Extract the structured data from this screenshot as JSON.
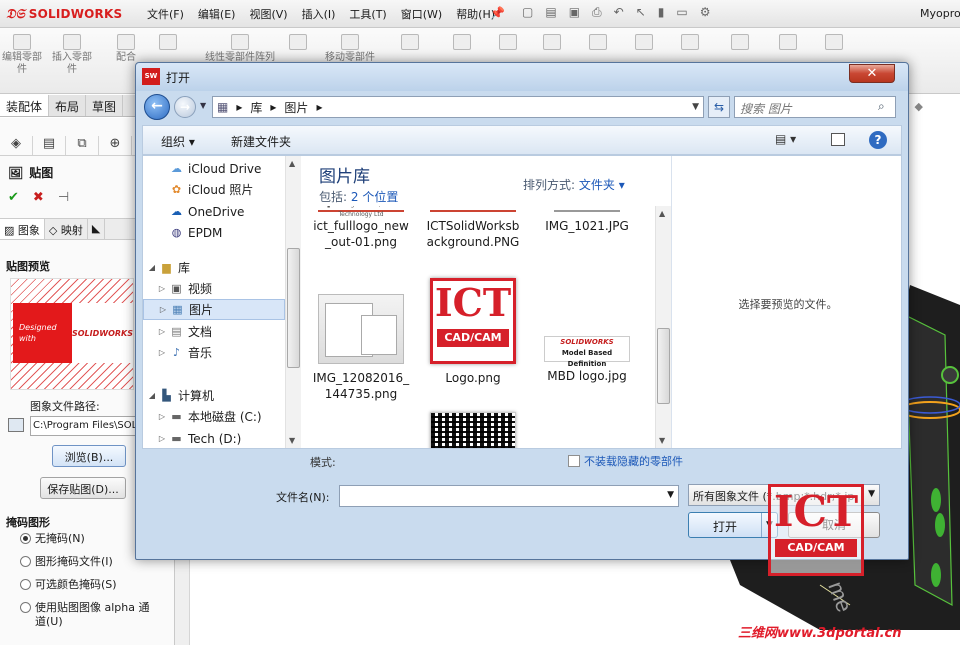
{
  "app": {
    "logo_text": "SOLIDWORKS",
    "menus": [
      "文件(F)",
      "编辑(E)",
      "视图(V)",
      "插入(I)",
      "工具(T)",
      "窗口(W)",
      "帮助(H)"
    ],
    "doc_title": "Myopro"
  },
  "ribbon": {
    "buttons": [
      "编辑零部件",
      "插入零部件",
      "配合",
      "",
      "线性零部件阵列",
      "",
      "移动零部件",
      "",
      "",
      "",
      "",
      "",
      "",
      "",
      "",
      "",
      ""
    ]
  },
  "tabs": [
    "装配体",
    "布局",
    "草图"
  ],
  "property_manager": {
    "title": "贴图",
    "subtabs": [
      "图象",
      "映射",
      ""
    ],
    "preview_heading": "贴图预览",
    "preview_text_1": "Designed",
    "preview_text_2": "with",
    "preview_brand": "SOLIDWORKS",
    "path_label": "图象文件路径:",
    "path_value": "C:\\Program Files\\SOLIDWORKS",
    "browse_button": "浏览(B)...",
    "save_button": "保存贴图(D)...",
    "mask_heading": "掩码图形",
    "mask_options": [
      "无掩码(N)",
      "图形掩码文件(I)",
      "可选颜色掩码(S)",
      "使用贴图图像 alpha 通道(U)"
    ],
    "mask_selected": 0
  },
  "dialog": {
    "title": "打开",
    "address": [
      "库",
      "图片"
    ],
    "search_placeholder": "搜索 图片",
    "organize": "组织 ▾",
    "new_folder": "新建文件夹",
    "library_title": "图片库",
    "includes_label": "包括:",
    "includes_link": "2 个位置",
    "sort_label": "排列方式:",
    "sort_value": "文件夹 ▾",
    "preview_message": "选择要预览的文件。",
    "mode_label": "模式:",
    "hidden_checkbox": "不装载隐藏的零部件",
    "filename_label": "文件名(N):",
    "filename_value": "",
    "filetype": "所有图象文件 (*.bmp;*.hdr;*.jp",
    "open_button": "打开",
    "cancel_button": "取消",
    "nav_items": [
      {
        "label": "iCloud Drive",
        "icon": "cloud-icon",
        "level": 1
      },
      {
        "label": "iCloud 照片",
        "icon": "photos-icon",
        "level": 1
      },
      {
        "label": "OneDrive",
        "icon": "onedrive-icon",
        "level": 1
      },
      {
        "label": "EPDM",
        "icon": "vault-icon",
        "level": 1
      },
      {
        "label": "库",
        "icon": "library-icon",
        "level": 0
      },
      {
        "label": "视频",
        "icon": "video-icon",
        "level": 1
      },
      {
        "label": "图片",
        "icon": "pictures-icon",
        "level": 1,
        "selected": true
      },
      {
        "label": "文档",
        "icon": "documents-icon",
        "level": 1
      },
      {
        "label": "音乐",
        "icon": "music-icon",
        "level": 1
      },
      {
        "label": "计算机",
        "icon": "computer-icon",
        "level": 0
      },
      {
        "label": "本地磁盘 (C:)",
        "icon": "drive-icon",
        "level": 1
      },
      {
        "label": "Tech (D:)",
        "icon": "drive-icon",
        "level": 1
      }
    ],
    "files": [
      {
        "name": "ict_fulllogo_new_out-01.png",
        "thumb": "ict-full-logo"
      },
      {
        "name": "ICTSolidWorksbackground.PNG",
        "thumb": "background"
      },
      {
        "name": "IMG_1021.JPG",
        "thumb": "photo"
      },
      {
        "name": "IMG_12082016_144735.png",
        "thumb": "screenshot"
      },
      {
        "name": "Logo.png",
        "thumb": "ict-logo"
      },
      {
        "name": "MBD logo.jpg",
        "thumb": "mbd-logo"
      },
      {
        "name": "",
        "thumb": "qr-code"
      }
    ],
    "ict_logo_text": "ICT",
    "ict_logo_sub": "CAD/CAM",
    "mbd_brand": "SOLIDWORKS",
    "mbd_caption": "Model Based Definition"
  },
  "watermark": {
    "logo_text": "ICT",
    "logo_sub": "CAD/CAM",
    "site": "三维网www.3dportal.cn"
  },
  "colors": {
    "brand_red": "#d6202a",
    "dialog_frame": "#c9dbee",
    "link_blue": "#1c58b8"
  }
}
